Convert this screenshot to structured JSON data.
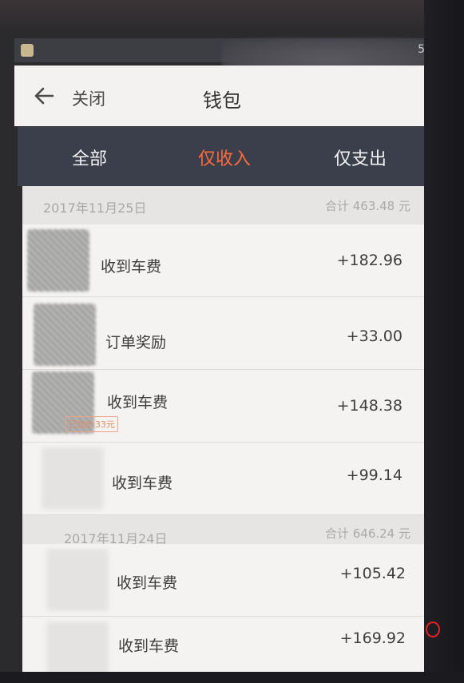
{
  "status_bar": {
    "right_text": "5"
  },
  "header": {
    "close_label": "关闭",
    "title": "钱包"
  },
  "tabs": [
    {
      "label": "全部",
      "active": false
    },
    {
      "label": "仅收入",
      "active": true
    },
    {
      "label": "仅支出",
      "active": false
    }
  ],
  "colors": {
    "active_tab": "#ff6a3a",
    "tab_bar": "#3b3f4c"
  },
  "days": [
    {
      "date": "2017年11月25日",
      "total": "合计 463.48 元",
      "items": [
        {
          "label": "收到车费",
          "amount": "+182.96"
        },
        {
          "label": "订单奖励",
          "amount": "+33.00"
        },
        {
          "label": "收到车费",
          "amount": "+148.38",
          "tag": "已加价33元"
        },
        {
          "label": "收到车费",
          "amount": "+99.14"
        }
      ]
    },
    {
      "date": "2017年11月24日",
      "total": "合计 646.24 元",
      "items": [
        {
          "label": "收到车费",
          "amount": "+105.42"
        },
        {
          "label": "收到车费",
          "amount": "+169.92"
        }
      ]
    }
  ]
}
